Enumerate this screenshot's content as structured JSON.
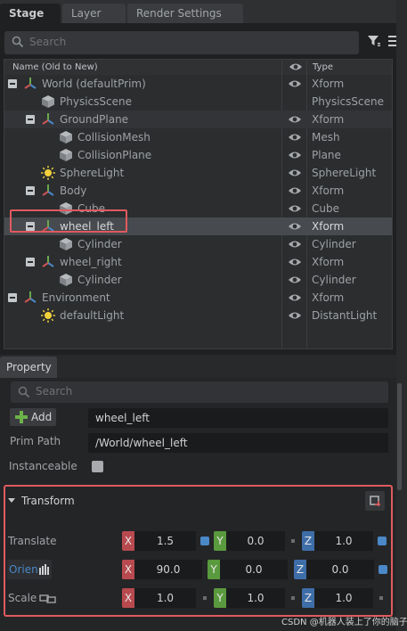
{
  "tabs": [
    "Stage",
    "Layer",
    "Render Settings"
  ],
  "stage": {
    "search_placeholder": "Search",
    "columns": {
      "name": "Name (Old to New)",
      "type": "Type"
    },
    "tree": [
      {
        "label": "World (defaultPrim)",
        "type": "Xform",
        "icon": "xform-icon",
        "depth": 0,
        "expander": true,
        "eye": true
      },
      {
        "label": "PhysicsScene",
        "type": "PhysicsScene",
        "icon": "cube-icon",
        "depth": 1,
        "expander": false,
        "eye": false
      },
      {
        "label": "GroundPlane",
        "type": "Xform",
        "icon": "xform-icon",
        "depth": 1,
        "expander": true,
        "eye": true
      },
      {
        "label": "CollisionMesh",
        "type": "Mesh",
        "icon": "cube-icon",
        "depth": 2,
        "expander": false,
        "eye": true
      },
      {
        "label": "CollisionPlane",
        "type": "Plane",
        "icon": "cube-icon",
        "depth": 2,
        "expander": false,
        "eye": true
      },
      {
        "label": "SphereLight",
        "type": "SphereLight",
        "icon": "light-icon",
        "depth": 1,
        "expander": false,
        "eye": true
      },
      {
        "label": "Body",
        "type": "Xform",
        "icon": "xform-icon",
        "depth": 1,
        "expander": true,
        "eye": true
      },
      {
        "label": "Cube",
        "type": "Cube",
        "icon": "cube-icon",
        "depth": 2,
        "expander": false,
        "eye": true
      },
      {
        "label": "wheel_left",
        "type": "Xform",
        "icon": "xform-icon",
        "depth": 1,
        "expander": true,
        "eye": true,
        "selected": true
      },
      {
        "label": "Cylinder",
        "type": "Cylinder",
        "icon": "cube-icon",
        "depth": 2,
        "expander": false,
        "eye": true
      },
      {
        "label": "wheel_right",
        "type": "Xform",
        "icon": "xform-icon",
        "depth": 1,
        "expander": true,
        "eye": true
      },
      {
        "label": "Cylinder",
        "type": "Cylinder",
        "icon": "cube-icon",
        "depth": 2,
        "expander": false,
        "eye": true
      },
      {
        "label": "Environment",
        "type": "Xform",
        "icon": "xform-icon",
        "depth": 0,
        "expander": true,
        "eye": true
      },
      {
        "label": "defaultLight",
        "type": "DistantLight",
        "icon": "light-icon",
        "depth": 1,
        "expander": false,
        "eye": true
      }
    ]
  },
  "property": {
    "tab_label": "Property",
    "search_placeholder": "Search",
    "add_label": "Add",
    "name_value": "wheel_left",
    "prim_path_label": "Prim Path",
    "prim_path_value": "/World/wheel_left",
    "instanceable_label": "Instanceable",
    "transform": {
      "title": "Transform",
      "translate": {
        "label": "Translate",
        "x": "1.5",
        "y": "0.0",
        "z": "1.0"
      },
      "orient": {
        "label": "Orien",
        "x": "90.0",
        "y": "0.0",
        "z": "0.0"
      },
      "scale": {
        "label": "Scale",
        "x": "1.0",
        "y": "1.0",
        "z": "1.0"
      }
    }
  },
  "axis_letters": {
    "x": "X",
    "y": "Y",
    "z": "Z"
  },
  "watermark": "CSDN @机器人装上了你的脑子",
  "colors": {
    "axis_x": "#b84a4f",
    "axis_y": "#5a9a3e",
    "axis_z": "#3e6ea8",
    "highlight": "#e05a5f"
  }
}
